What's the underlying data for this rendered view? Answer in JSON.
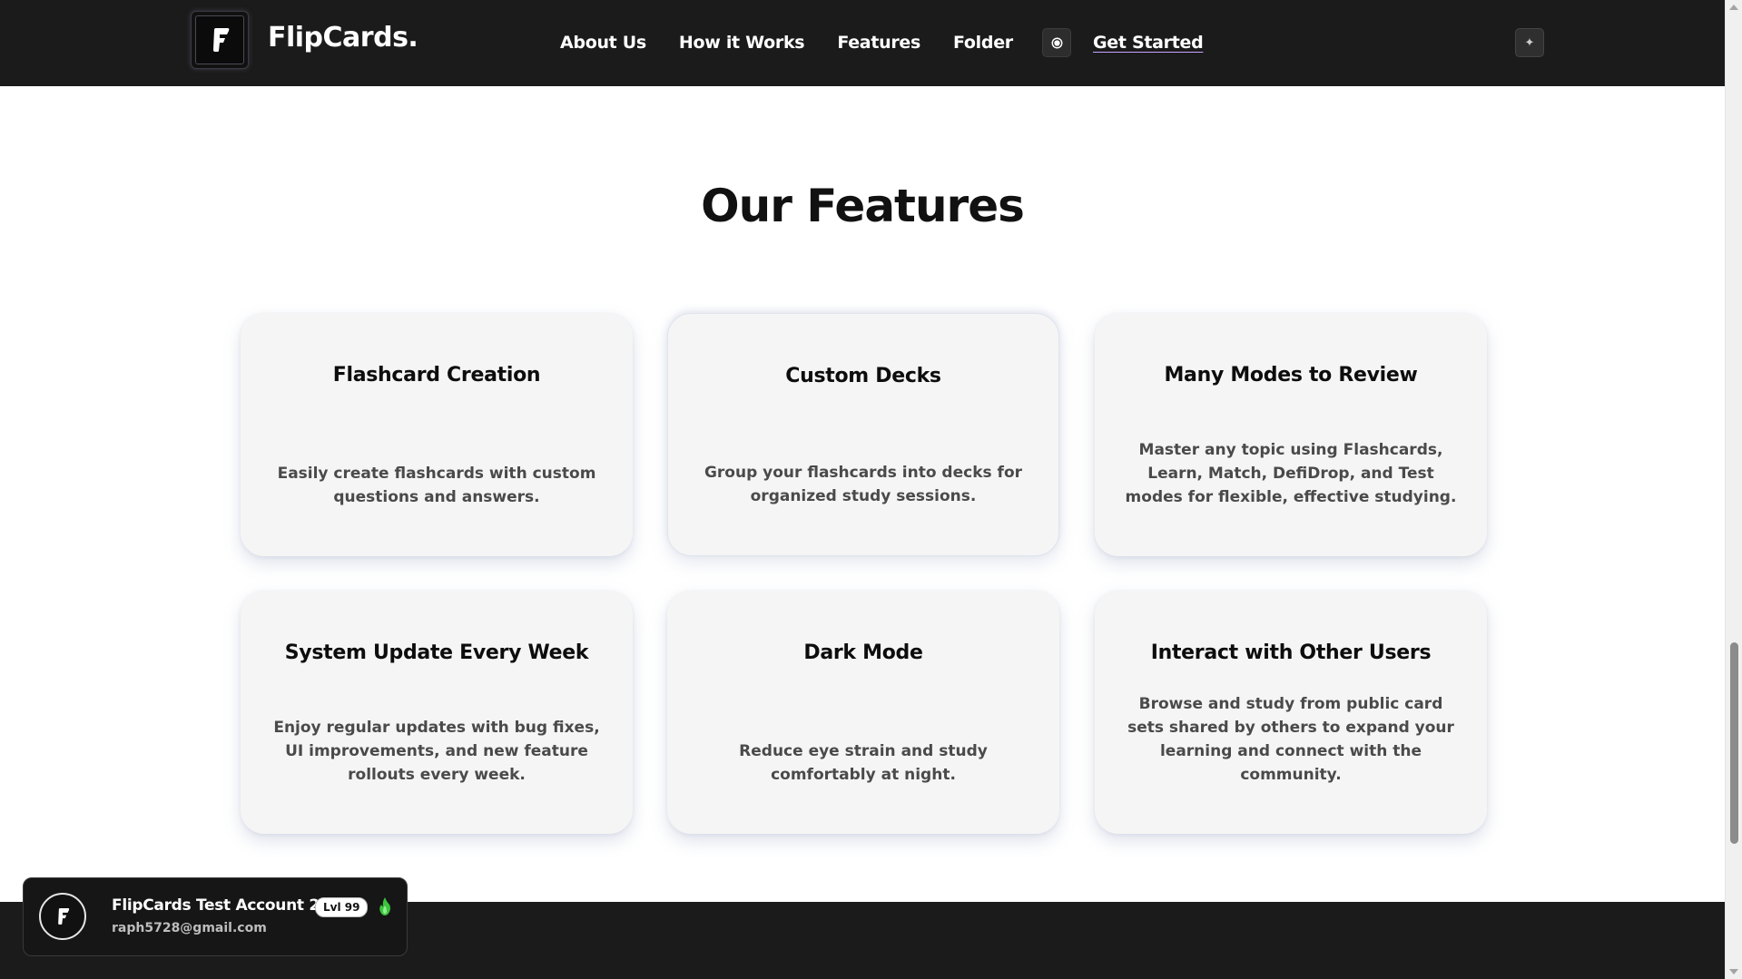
{
  "nav": {
    "brand": "FlipCards.",
    "links": [
      "About Us",
      "How it Works",
      "Features",
      "Folder"
    ],
    "cta": "Get Started",
    "logo_icon": "flipcards-logo-icon",
    "theme_icon": "theme-toggle-icon",
    "extra_icon": "sparkle-icon"
  },
  "section": {
    "title": "Our Features"
  },
  "features": [
    {
      "title": "Flashcard Creation",
      "desc": "Easily create flashcards with custom questions and answers."
    },
    {
      "title": "Custom Decks",
      "desc": "Group your flashcards into decks for organized study sessions."
    },
    {
      "title": "Many Modes to Review",
      "desc": "Master any topic using Flashcards, Learn, Match, DefiDrop, and Test modes for flexible, effective studying."
    },
    {
      "title": "System Update Every Week",
      "desc": "Enjoy regular updates with bug fixes, UI improvements, and new feature rollouts every week."
    },
    {
      "title": "Dark Mode",
      "desc": "Reduce eye strain and study comfortably at night."
    },
    {
      "title": "Interact with Other Users",
      "desc": "Browse and study from public card sets shared by others to expand your learning and connect with the community."
    }
  ],
  "account": {
    "name": "FlipCards Test Account 2",
    "level": "Lvl 99",
    "email": "raph5728@gmail.com",
    "level_icon": "green-flame-icon"
  },
  "colors": {
    "nav_bg": "#1b1b1b",
    "card_bg": "#f5f5f5",
    "accent_underline": "#c9a4ff",
    "level_flame": "#3cc43c"
  }
}
